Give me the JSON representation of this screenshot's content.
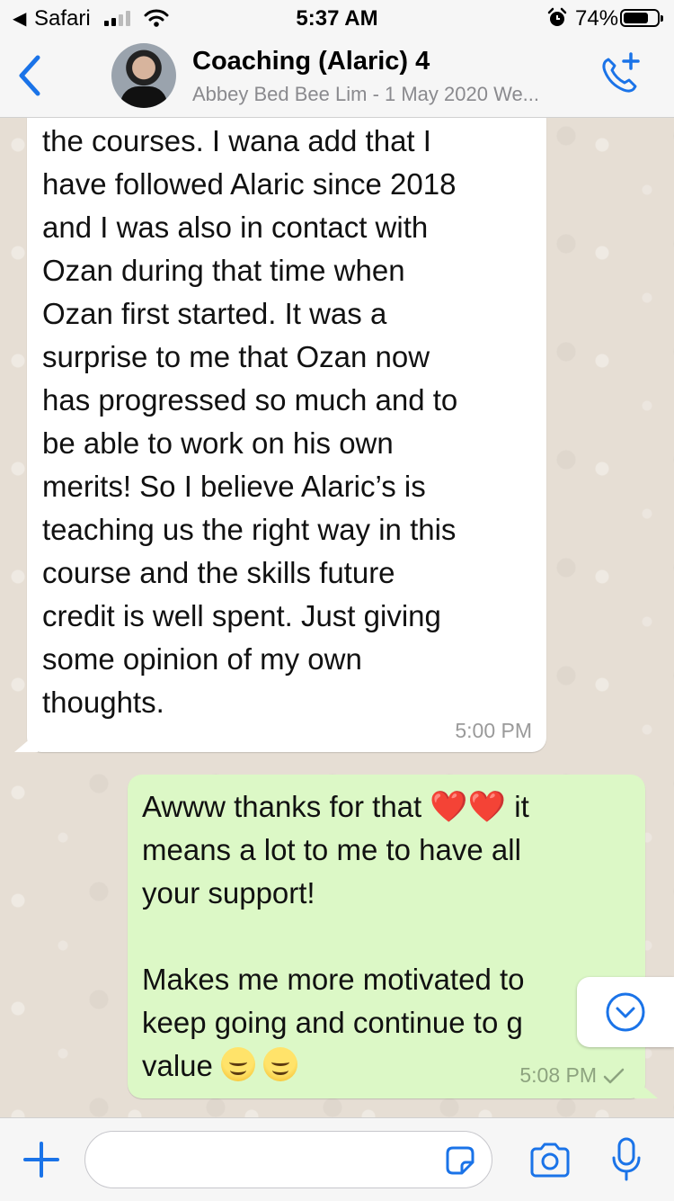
{
  "status_bar": {
    "back_app": "Safari",
    "time": "5:37 AM",
    "battery_percent": "74%",
    "battery_level": 0.74,
    "icons": [
      "back-arrow-icon",
      "signal-icon",
      "wifi-icon",
      "alarm-icon",
      "battery-icon"
    ]
  },
  "header": {
    "title": "Coaching (Alaric) 4",
    "subtitle": "Abbey Bed Bee Lim - 1 May 2020 We...",
    "icons": [
      "back-chevron-icon",
      "avatar",
      "add-call-icon"
    ]
  },
  "messages": [
    {
      "direction": "incoming",
      "text": "for us to be able to go through\nthe courses. I wana add that I\nhave followed Alaric since 2018\nand I was also in contact with\nOzan during that time when\nOzan first started. It was a\nsurprise to me that Ozan now\nhas progressed so much and to\nbe able to work on his own\nmerits! So I believe Alaric’s is\nteaching us the right way in this\ncourse and the skills future\ncredit is well spent. Just giving\nsome opinion of my own\nthoughts.",
      "time": "5:00 PM"
    },
    {
      "direction": "outgoing",
      "line1": "Awww thanks for that ",
      "line1_end": " it",
      "line2": "means a lot to me to have all\nyour support!\n\nMakes me more motivated to\nkeep going and continue to g",
      "line3": "value ",
      "hearts": [
        "❤️",
        "❤️"
      ],
      "time": "5:08 PM",
      "status_icon": "single-check-icon"
    }
  ],
  "composer": {
    "placeholder": "",
    "icons": [
      "plus-icon",
      "sticker-icon",
      "camera-icon",
      "microphone-icon"
    ]
  },
  "colors": {
    "accent": "#1a73e8",
    "chat_background": "#e6ded4",
    "incoming_bubble": "#ffffff",
    "outgoing_bubble": "#dcf8c6"
  }
}
